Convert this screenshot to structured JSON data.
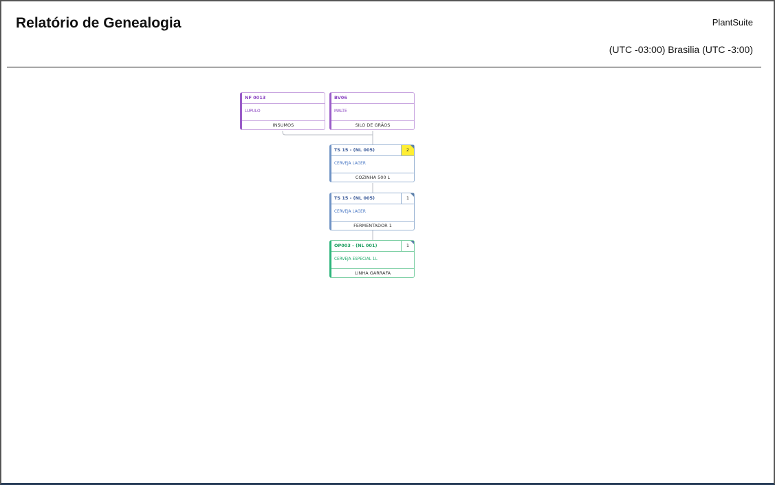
{
  "report": {
    "title": "Relatório de Genealogia",
    "brand": "PlantSuite",
    "timezone": "(UTC -03:00) Brasilia (UTC -3:00)"
  },
  "colors": {
    "input_accent": "#9a5cc8",
    "batch_accent": "#6e92c4",
    "order_accent": "#2ab47a",
    "highlight_count": "#ffee33"
  },
  "nodes": [
    {
      "code": "NF 0013",
      "product": "LUPULO",
      "location": "INSUMOS",
      "count": ""
    },
    {
      "code": "BV06",
      "product": "MALTE",
      "location": "SILO DE GRÃOS",
      "count": ""
    },
    {
      "code": "TS 15 - (NL 005)",
      "product": "CERVEJA LAGER",
      "location": "COZINHA 500 L",
      "count": "2"
    },
    {
      "code": "TS 15 - (NL 005)",
      "product": "CERVEJA LAGER",
      "location": "FERMENTADOR 1",
      "count": "1"
    },
    {
      "code": "OP003 - (NL 001)",
      "product": "CERVEJA ESPECIAL 1L",
      "location": "LINHA GARRAFA",
      "count": "1"
    }
  ]
}
